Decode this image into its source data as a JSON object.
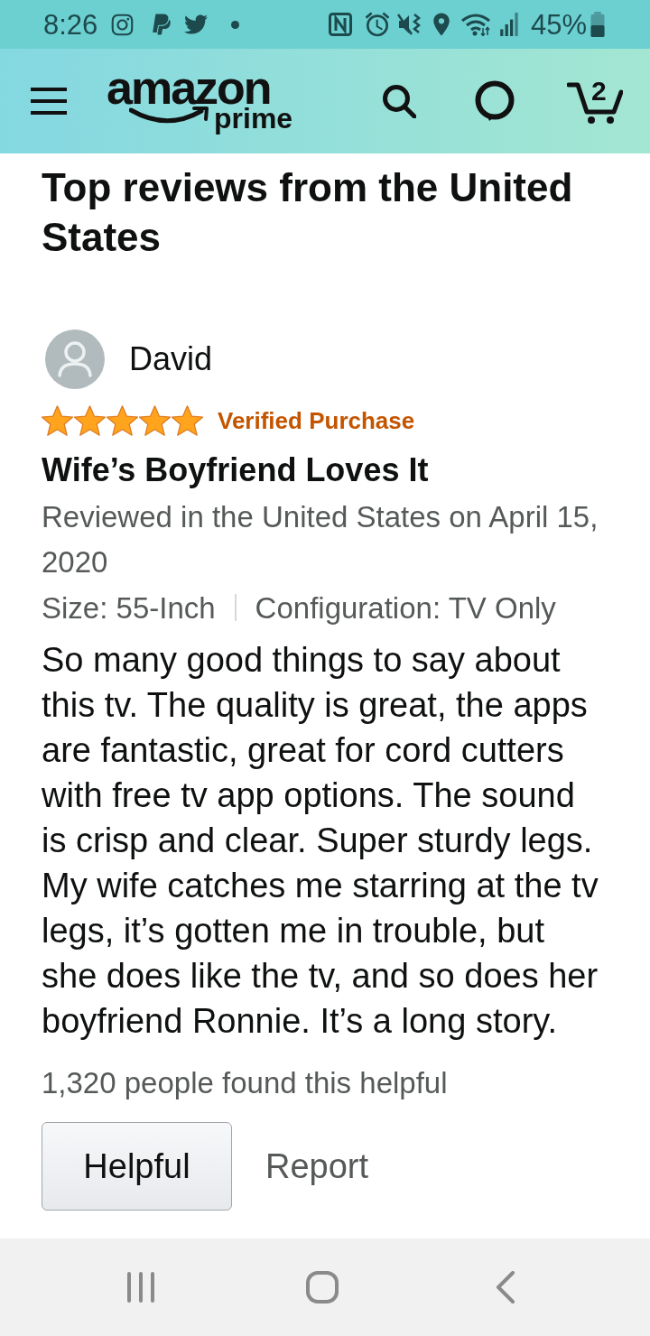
{
  "status_bar": {
    "time": "8:26",
    "battery": "45%"
  },
  "header": {
    "logo": {
      "wordmark": "amazon",
      "tier": "prime"
    },
    "cart_count": "2"
  },
  "section_title": "Top reviews from the United States",
  "review": {
    "author": "David",
    "stars": 5,
    "badge": "Verified Purchase",
    "title": "Wife’s Boyfriend Loves It",
    "date_line": "Reviewed in the United States on April 15, 2020",
    "variants": [
      "Size: 55-Inch",
      "Configuration: TV Only"
    ],
    "body": "So many good things to say about this tv. The quality is great, the apps are fantastic, great for cord cutters with free tv app options. The sound is crisp and clear. Super sturdy legs. My wife catches me starring at the tv legs, it’s gotten me in trouble, but she does like the tv, and so does her boyfriend Ronnie. It’s a long story.",
    "helpful_count": "1,320 people found this helpful",
    "actions": [
      {
        "kind": "button",
        "label": "Helpful"
      },
      {
        "kind": "link",
        "label": "Report"
      }
    ]
  }
}
